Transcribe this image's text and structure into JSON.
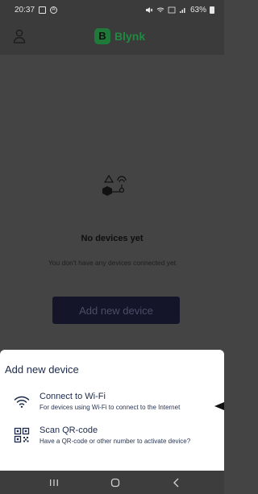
{
  "status_bar": {
    "time": "20:37",
    "battery": "63%",
    "icons": [
      "gallery-icon",
      "a-icon",
      "mute-icon",
      "wifi-icon",
      "lte-icon",
      "signal-icon",
      "battery-icon"
    ]
  },
  "header": {
    "logo_letter": "B",
    "logo_text": "Blynk",
    "brand_color": "#1f8a40",
    "icons": [
      "user-icon"
    ]
  },
  "empty_state": {
    "title": "No devices yet",
    "subtitle": "You don't have any devices connected yet",
    "button_label": "Add new device",
    "icon": "devices-illustration-icon"
  },
  "sheet": {
    "title": "Add new device",
    "options": [
      {
        "title": "Connect to Wi-Fi",
        "subtitle": "For devices using Wi-Fi to connect to the Internet",
        "icon": "wifi-icon"
      },
      {
        "title": "Scan QR-code",
        "subtitle": "Have a QR-code or other number to activate device?",
        "icon": "qr-code-icon"
      }
    ]
  },
  "nav": {
    "buttons": [
      "recent-apps-icon",
      "home-icon",
      "back-icon"
    ]
  }
}
